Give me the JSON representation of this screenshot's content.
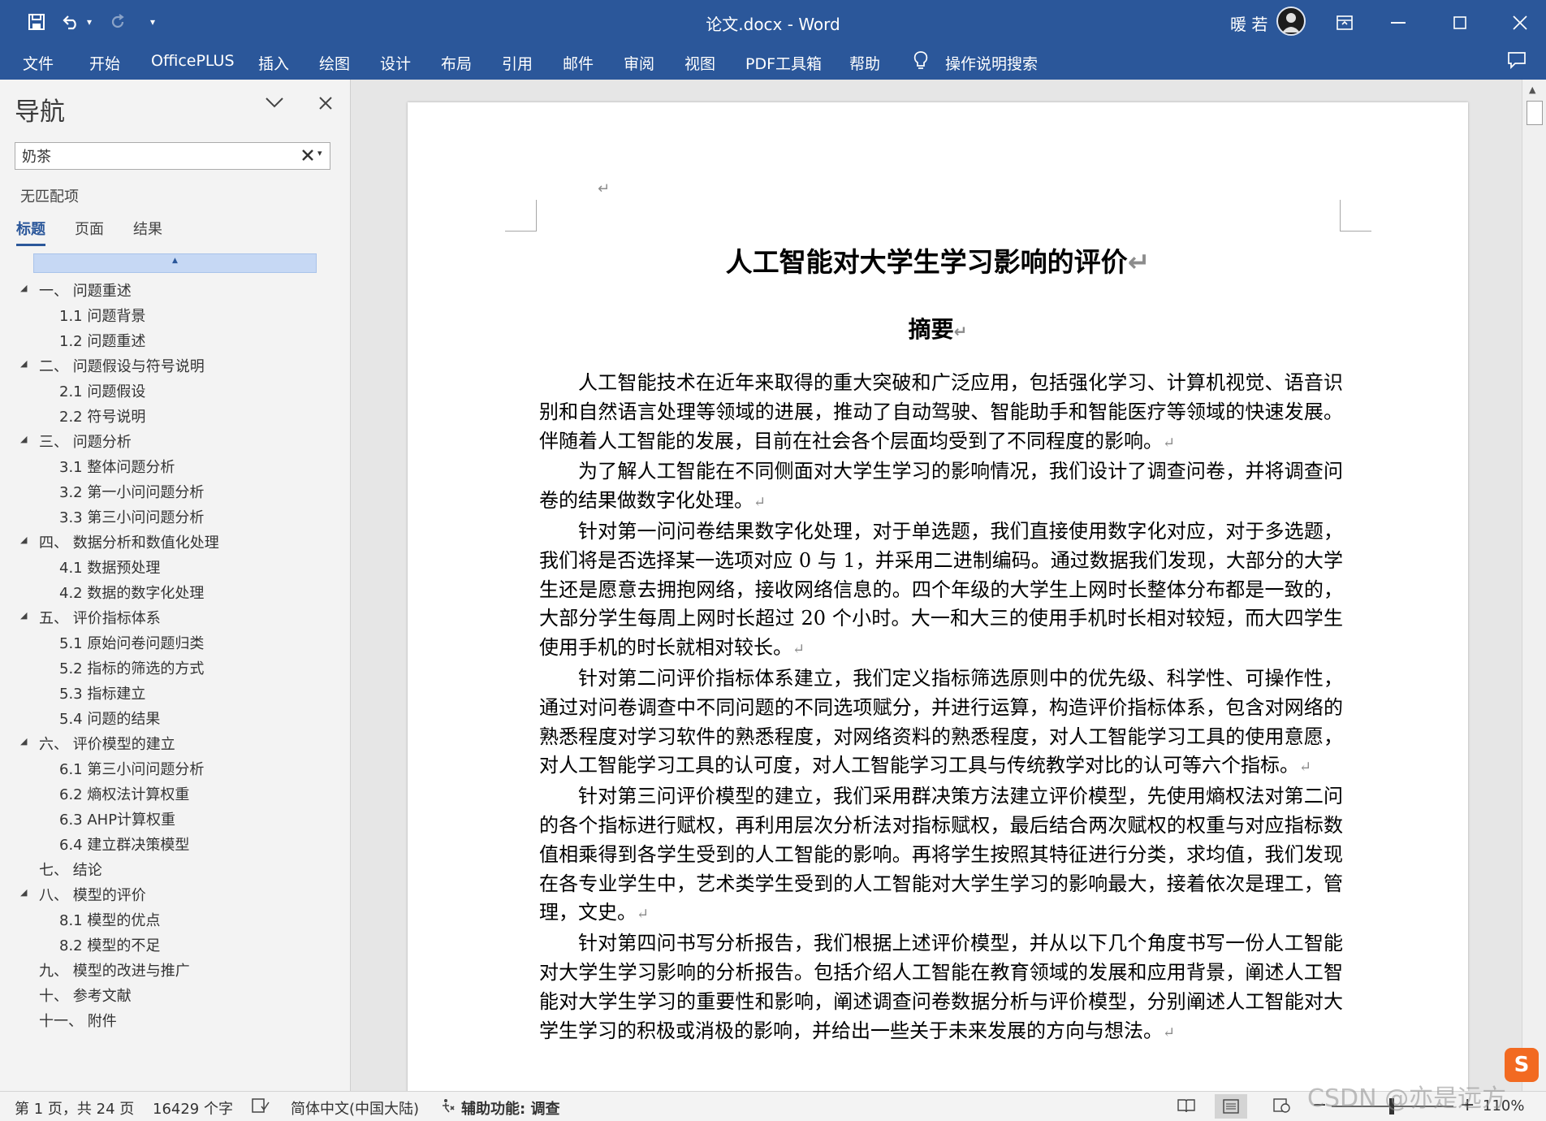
{
  "window": {
    "title": "论文.docx  -  Word",
    "user_name": "暖 若"
  },
  "ribbon_tabs": [
    "文件",
    "开始",
    "OfficePLUS",
    "插入",
    "绘图",
    "设计",
    "布局",
    "引用",
    "邮件",
    "审阅",
    "视图",
    "PDF工具箱",
    "帮助"
  ],
  "tell_me": "操作说明搜索",
  "navigation": {
    "title": "导航",
    "search_value": "奶茶",
    "no_match": "无匹配项",
    "tabs": [
      "标题",
      "页面",
      "结果"
    ],
    "outline": [
      {
        "label": "一、 问题重述",
        "level": 1,
        "expanded": true
      },
      {
        "label": "1.1 问题背景",
        "level": 2
      },
      {
        "label": "1.2 问题重述",
        "level": 2
      },
      {
        "label": "二、 问题假设与符号说明",
        "level": 1,
        "expanded": true
      },
      {
        "label": "2.1 问题假设",
        "level": 2
      },
      {
        "label": "2.2 符号说明",
        "level": 2
      },
      {
        "label": "三、 问题分析",
        "level": 1,
        "expanded": true
      },
      {
        "label": "3.1 整体问题分析",
        "level": 2
      },
      {
        "label": "3.2 第一小问问题分析",
        "level": 2
      },
      {
        "label": "3.3 第三小问问题分析",
        "level": 2
      },
      {
        "label": "四、 数据分析和数值化处理",
        "level": 1,
        "expanded": true
      },
      {
        "label": "4.1 数据预处理",
        "level": 2
      },
      {
        "label": "4.2 数据的数字化处理",
        "level": 2
      },
      {
        "label": "五、 评价指标体系",
        "level": 1,
        "expanded": true
      },
      {
        "label": "5.1 原始问卷问题归类",
        "level": 2
      },
      {
        "label": "5.2 指标的筛选的方式",
        "level": 2
      },
      {
        "label": "5.3 指标建立",
        "level": 2
      },
      {
        "label": "5.4 问题的结果",
        "level": 2
      },
      {
        "label": "六、 评价模型的建立",
        "level": 1,
        "expanded": true
      },
      {
        "label": "6.1 第三小问问题分析",
        "level": 2
      },
      {
        "label": "6.2 熵权法计算权重",
        "level": 2
      },
      {
        "label": "6.3 AHP计算权重",
        "level": 2
      },
      {
        "label": "6.4 建立群决策模型",
        "level": 2
      },
      {
        "label": "七、 结论",
        "level": 1,
        "expanded": false
      },
      {
        "label": "八、 模型的评价",
        "level": 1,
        "expanded": true
      },
      {
        "label": "8.1 模型的优点",
        "level": 2
      },
      {
        "label": "8.2 模型的不足",
        "level": 2
      },
      {
        "label": "九、 模型的改进与推广",
        "level": 1,
        "expanded": false
      },
      {
        "label": "十、 参考文献",
        "level": 1,
        "expanded": false
      },
      {
        "label": "十一、 附件",
        "level": 1,
        "expanded": false
      }
    ]
  },
  "document": {
    "title": "人工智能对大学生学习影响的评价",
    "subtitle": "摘要",
    "paragraphs": [
      "人工智能技术在近年来取得的重大突破和广泛应用，包括强化学习、计算机视觉、语音识别和自然语言处理等领域的进展，推动了自动驾驶、智能助手和智能医疗等领域的快速发展。伴随着人工智能的发展，目前在社会各个层面均受到了不同程度的影响。",
      "为了解人工智能在不同侧面对大学生学习的影响情况，我们设计了调查问卷，并将调查问卷的结果做数字化处理。",
      "针对第一问问卷结果数字化处理，对于单选题，我们直接使用数字化对应，对于多选题，我们将是否选择某一选项对应 0 与 1，并采用二进制编码。通过数据我们发现，大部分的大学生还是愿意去拥抱网络，接收网络信息的。四个年级的大学生上网时长整体分布都是一致的，大部分学生每周上网时长超过 20 个小时。大一和大三的使用手机时长相对较短，而大四学生使用手机的时长就相对较长。",
      "针对第二问评价指标体系建立，我们定义指标筛选原则中的优先级、科学性、可操作性，通过对问卷调查中不同问题的不同选项赋分，并进行运算，构造评价指标体系，包含对网络的熟悉程度对学习软件的熟悉程度，对网络资料的熟悉程度，对人工智能学习工具的使用意愿，对人工智能学习工具的认可度，对人工智能学习工具与传统教学对比的认可等六个指标。",
      "针对第三问评价模型的建立，我们采用群决策方法建立评价模型，先使用熵权法对第二问的各个指标进行赋权，再利用层次分析法对指标赋权，最后结合两次赋权的权重与对应指标数值相乘得到各学生受到的人工智能的影响。再将学生按照其特征进行分类，求均值，我们发现在各专业学生中，艺术类学生受到的人工智能对大学生学习的影响最大，接着依次是理工，管理，文史。",
      "针对第四问书写分析报告，我们根据上述评价模型，并从以下几个角度书写一份人工智能对大学生学习影响的分析报告。包括介绍人工智能在教育领域的发展和应用背景，阐述人工智能对大学生学习的重要性和影响，阐述调查问卷数据分析与评价模型，分别阐述人工智能对大学生学习的积极或消极的影响，并给出一些关于未来发展的方向与想法。"
    ]
  },
  "status_bar": {
    "page": "第 1 页，共 24 页",
    "words": "16429 个字",
    "language": "简体中文(中国大陆)",
    "accessibility": "辅助功能: 调查",
    "zoom": "110%"
  },
  "watermark": "CSDN @亦是远方",
  "badge": "S"
}
